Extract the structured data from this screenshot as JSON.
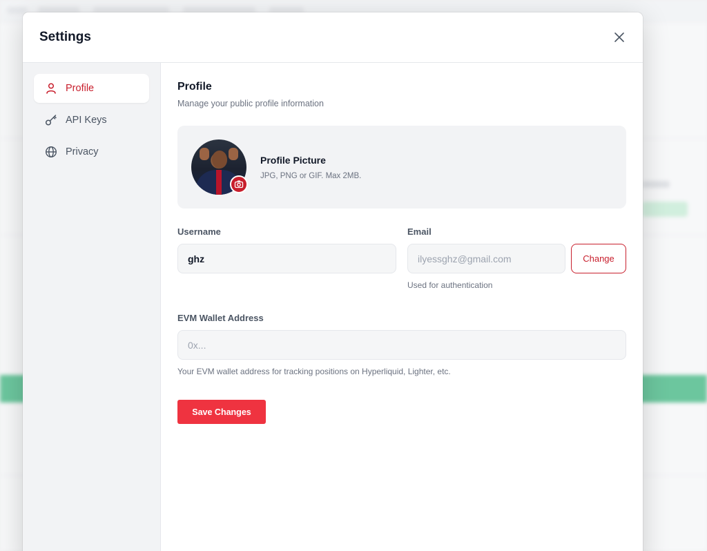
{
  "modal": {
    "title": "Settings"
  },
  "sidebar": {
    "items": [
      {
        "label": "Profile",
        "icon": "user-icon",
        "active": true
      },
      {
        "label": "API Keys",
        "icon": "key-icon",
        "active": false
      },
      {
        "label": "Privacy",
        "icon": "globe-icon",
        "active": false
      }
    ]
  },
  "profile": {
    "title": "Profile",
    "subtitle": "Manage your public profile information",
    "picture": {
      "title": "Profile Picture",
      "hint": "JPG, PNG or GIF. Max 2MB."
    },
    "username": {
      "label": "Username",
      "value": "ghz"
    },
    "email": {
      "label": "Email",
      "value": "ilyessghz@gmail.com",
      "change_label": "Change",
      "hint": "Used for authentication"
    },
    "wallet": {
      "label": "EVM Wallet Address",
      "placeholder": "0x...",
      "hint": "Your EVM wallet address for tracking positions on Hyperliquid, Lighter, etc."
    },
    "save_label": "Save Changes"
  },
  "colors": {
    "accent": "#c81e2c",
    "save_button": "#ef3340"
  }
}
